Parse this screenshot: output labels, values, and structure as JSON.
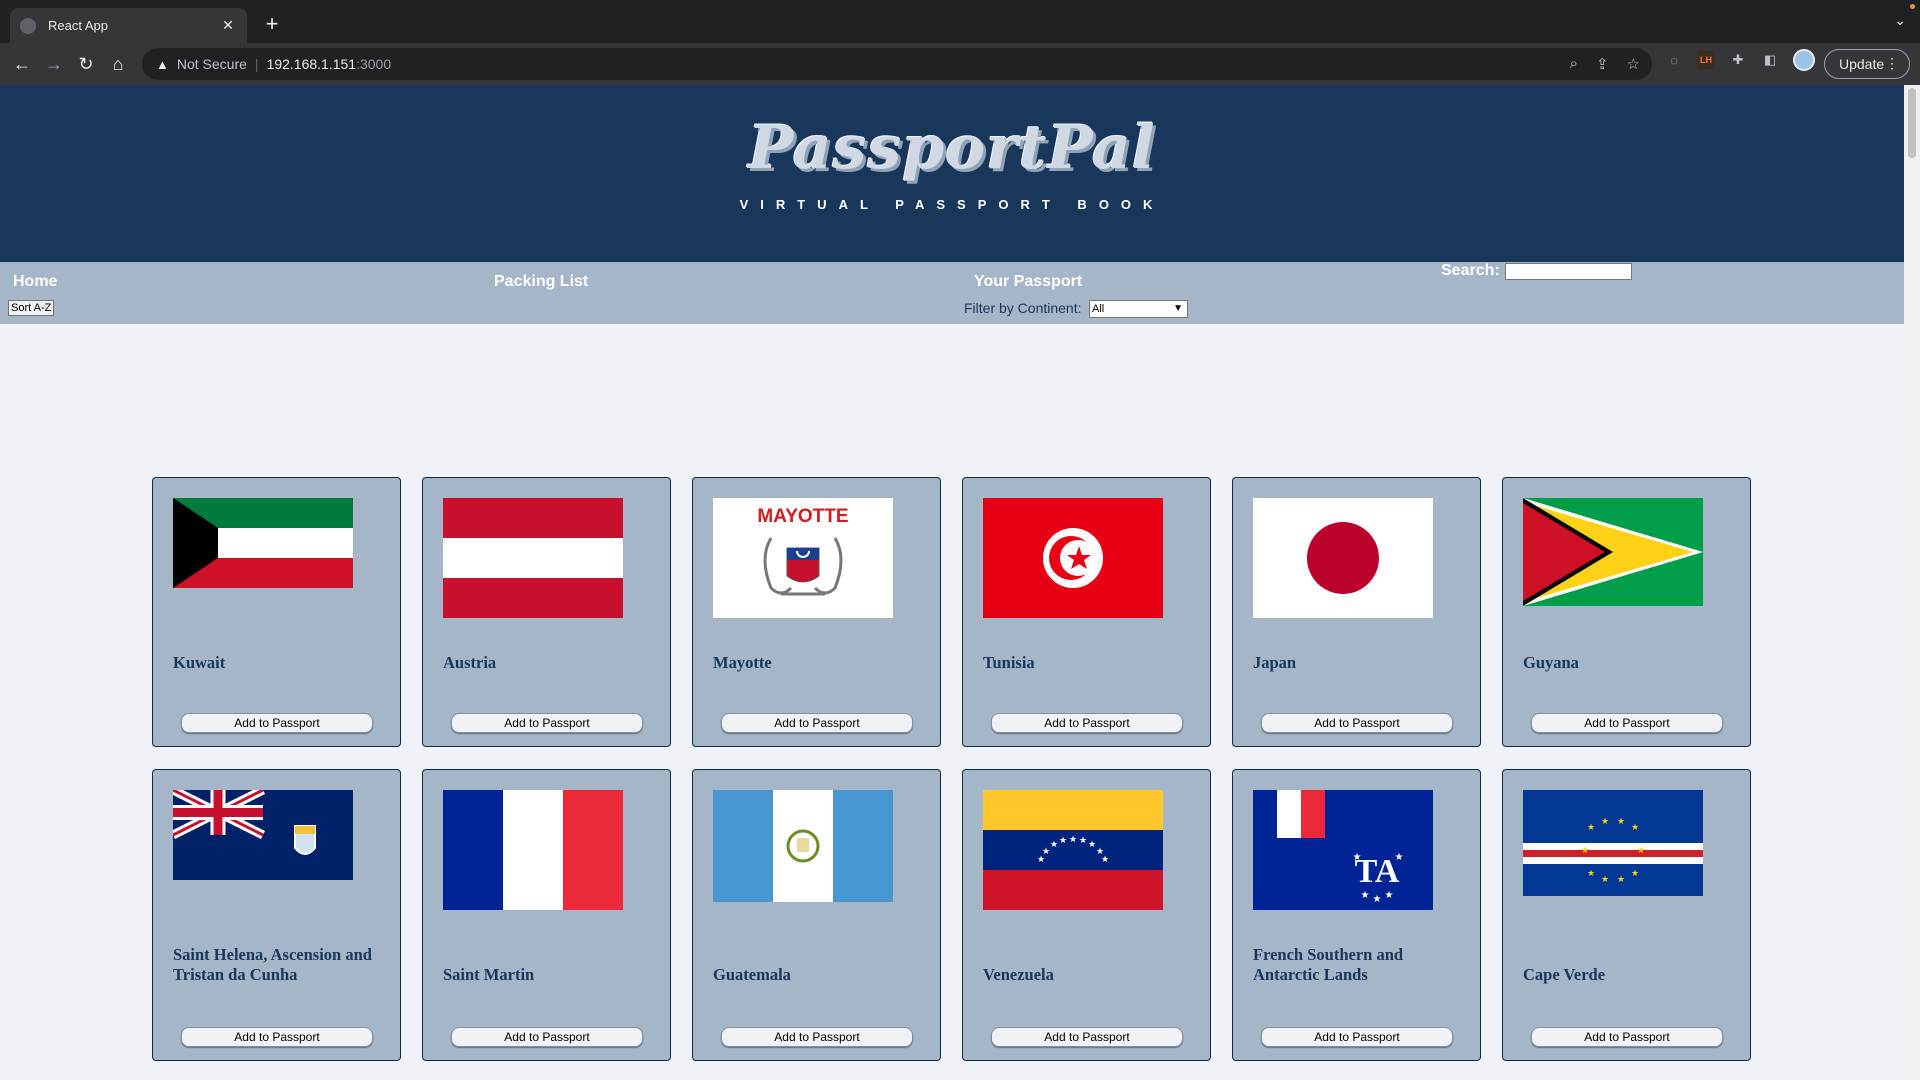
{
  "browser": {
    "tab_title": "React App",
    "security_label": "Not Secure",
    "url_host": "192.168.1.151",
    "url_port": ":3000",
    "update_label": "Update"
  },
  "site": {
    "logo": "PassportPal",
    "tagline": "VIRTUAL PASSPORT BOOK"
  },
  "nav": {
    "home": "Home",
    "packing_list": "Packing List",
    "your_passport": "Your Passport",
    "search_label": "Search:",
    "search_value": "",
    "sort_label": "Sort A-Z",
    "filter_label": "Filter by Continent:",
    "filter_value": "All"
  },
  "countries": [
    {
      "name": "Kuwait",
      "button": "Add to Passport"
    },
    {
      "name": "Austria",
      "button": "Add to Passport"
    },
    {
      "name": "Mayotte",
      "button": "Add to Passport",
      "flag_text": "MAYOTTE"
    },
    {
      "name": "Tunisia",
      "button": "Add to Passport"
    },
    {
      "name": "Japan",
      "button": "Add to Passport"
    },
    {
      "name": "Guyana",
      "button": "Add to Passport"
    },
    {
      "name": "Saint Helena, Ascension and Tristan da Cunha",
      "button": "Add to Passport"
    },
    {
      "name": "Saint Martin",
      "button": "Add to Passport"
    },
    {
      "name": "Guatemala",
      "button": "Add to Passport"
    },
    {
      "name": "Venezuela",
      "button": "Add to Passport"
    },
    {
      "name": "French Southern and Antarctic Lands",
      "button": "Add to Passport"
    },
    {
      "name": "Cape Verde",
      "button": "Add to Passport"
    }
  ]
}
